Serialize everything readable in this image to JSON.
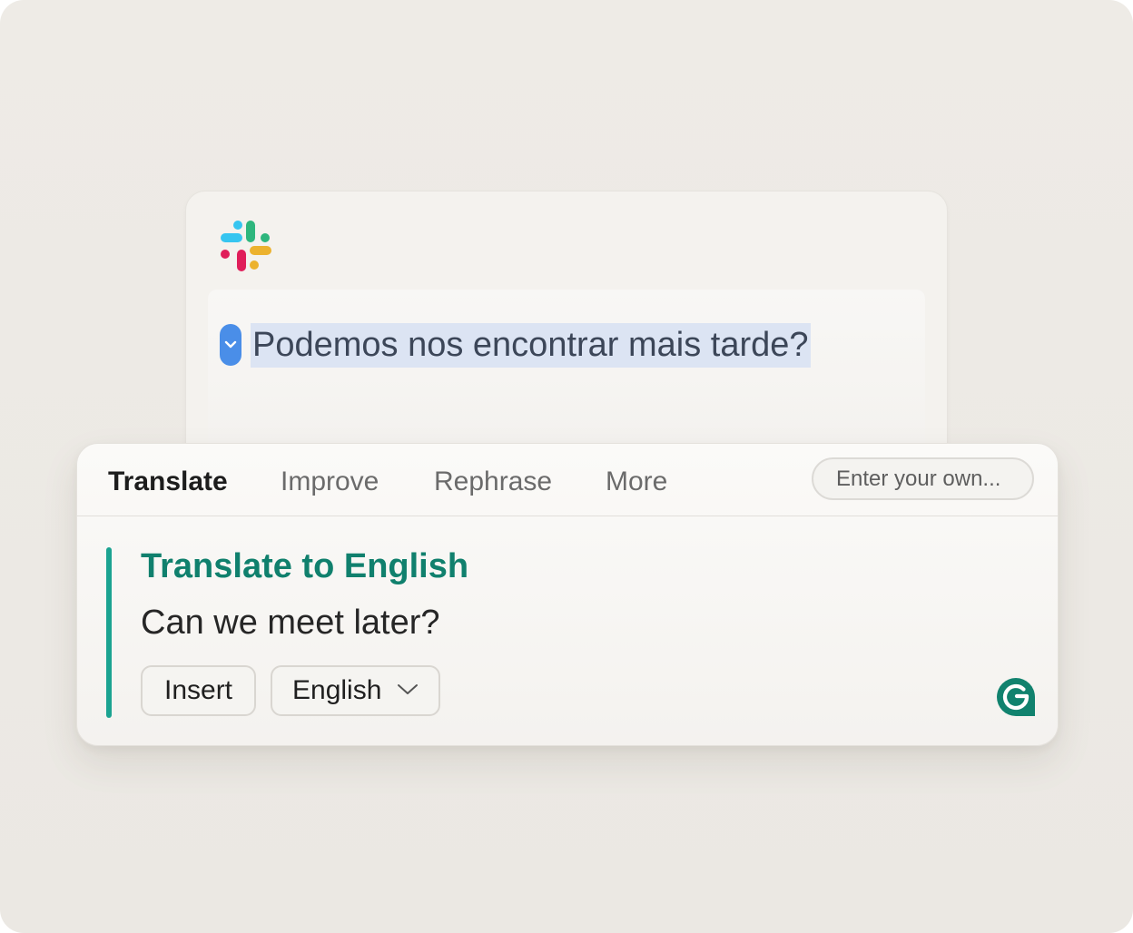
{
  "composer": {
    "message": "Podemos nos encontrar mais tarde?"
  },
  "popup": {
    "tabs": [
      {
        "label": "Translate",
        "active": true
      },
      {
        "label": "Improve",
        "active": false
      },
      {
        "label": "Rephrase",
        "active": false
      },
      {
        "label": "More",
        "active": false
      }
    ],
    "custom_prompt_placeholder": "Enter your own...",
    "suggestion": {
      "title": "Translate to English",
      "text": "Can we meet later?"
    },
    "actions": {
      "insert_label": "Insert",
      "language_label": "English"
    }
  },
  "icons": {
    "app": "slack-logo-icon",
    "assistant": "grammarly-logo-icon",
    "chip": "chevron-down-icon"
  },
  "colors": {
    "accent": "#10806d",
    "accent_bar": "#1ba391",
    "selection": "#dce4f3",
    "chip": "#4a8ee8"
  }
}
